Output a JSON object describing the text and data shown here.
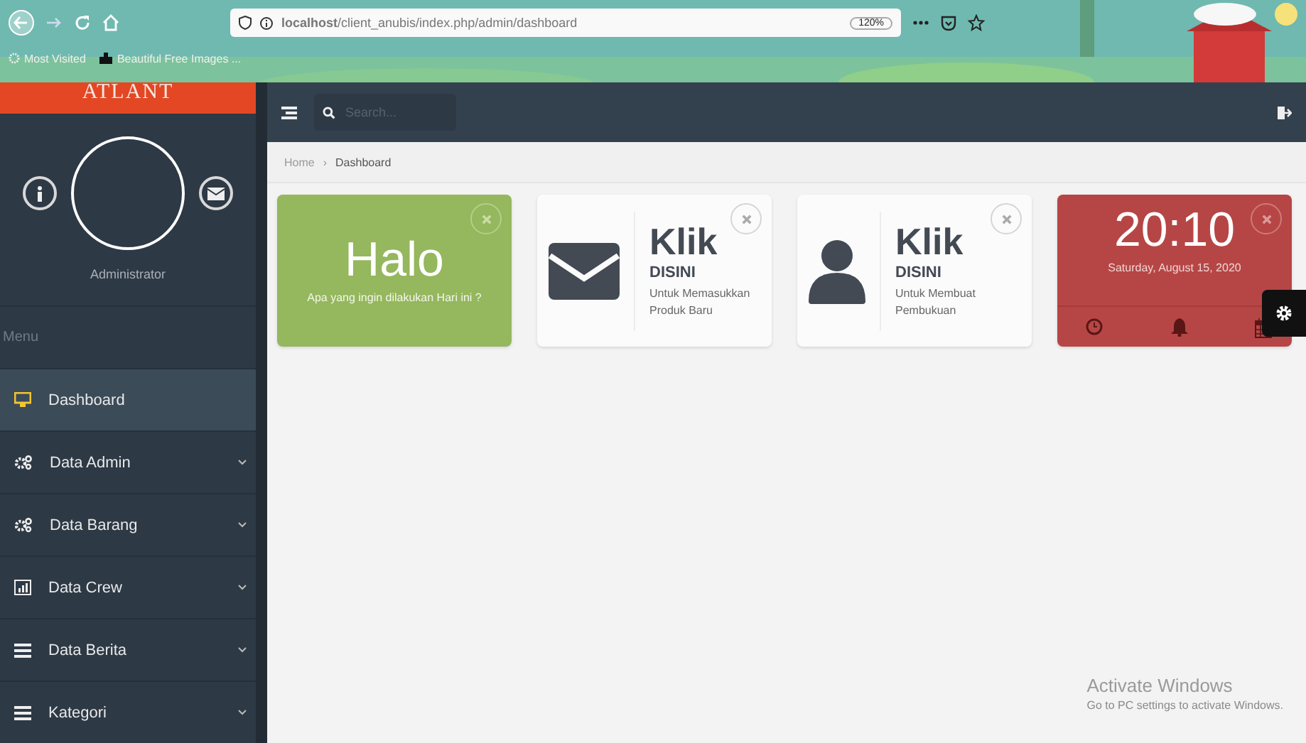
{
  "browser": {
    "url": "**localhost**/client_anubis/index.php/admin/dashboard",
    "zoom": "120%",
    "bookmarks": [
      "Most Visited",
      "Beautiful Free Images ..."
    ]
  },
  "sidebar": {
    "logo": "ATLANT",
    "profile_name": "Administrator",
    "menu_title": "Menu",
    "items": [
      {
        "label": "Dashboard",
        "kind": "page",
        "selected": true,
        "expandable": false
      },
      {
        "label": "Data Admin",
        "kind": "admin",
        "selected": false,
        "expandable": true
      },
      {
        "label": "Data Barang",
        "kind": "admin",
        "selected": false,
        "expandable": true
      },
      {
        "label": "Data Crew",
        "kind": "report",
        "selected": false,
        "expandable": true
      },
      {
        "label": "Data Berita",
        "kind": "content",
        "selected": false,
        "expandable": true
      },
      {
        "label": "Kategori",
        "kind": "content",
        "selected": false,
        "expandable": true
      }
    ]
  },
  "topbar": {
    "search": {
      "placeholder": "Search..."
    }
  },
  "breadcrumb": {
    "items": [
      "Home",
      "Dashboard"
    ],
    "separator": "›"
  },
  "tiles": [
    {
      "kind": "greeting",
      "title": "Halo",
      "text": "Apa yang ingin dilakukan Hari ini ?"
    },
    {
      "kind": "compose",
      "title": "Klik",
      "subtitle": "DISINI",
      "text": "Untuk Memasukkan Produk Baru"
    },
    {
      "kind": "profile",
      "title": "Klik",
      "subtitle": "DISINI",
      "text": "Untuk Membuat Pembukuan"
    },
    {
      "kind": "clock",
      "title": "20:10",
      "text": "Saturday, August 15, 2020"
    }
  ],
  "os_notice": {
    "title": "Activate Windows",
    "text": "Go to PC settings to activate Windows."
  }
}
